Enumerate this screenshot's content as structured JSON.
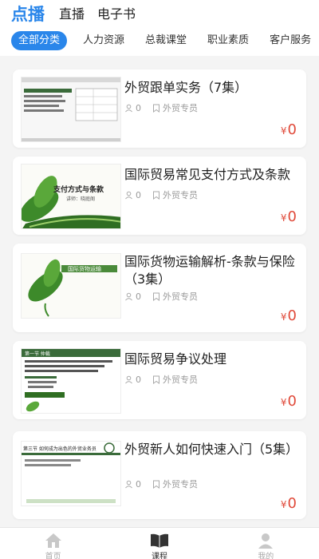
{
  "top_tabs": [
    "点播",
    "直播",
    "电子书"
  ],
  "categories": [
    "全部分类",
    "人力资源",
    "总裁课堂",
    "职业素质",
    "客户服务"
  ],
  "courses": [
    {
      "title": "外贸跟单实务（7集）",
      "count": "0",
      "tag": "外贸专员",
      "price": "0",
      "currency": "¥"
    },
    {
      "title": "国际贸易常见支付方式及条款",
      "count": "0",
      "tag": "外贸专员",
      "price": "0",
      "currency": "¥",
      "thumb_title": "支付方式与条款",
      "thumb_sub": "讲师：晓庭阁"
    },
    {
      "title": "国际货物运输解析-条款与保险（3集）",
      "count": "0",
      "tag": "外贸专员",
      "price": "0",
      "currency": "¥",
      "thumb_title": "国际货物运输"
    },
    {
      "title": "国际贸易争议处理",
      "count": "0",
      "tag": "外贸专员",
      "price": "0",
      "currency": "¥",
      "thumb_title": "第一节 仲裁"
    },
    {
      "title": "外贸新人如何快速入门（5集）",
      "count": "0",
      "tag": "外贸专员",
      "price": "0",
      "currency": "¥",
      "thumb_title": "第三节 如何成为出色的外贸业务员"
    }
  ],
  "bottom_nav": [
    "首页",
    "课程",
    "我的"
  ],
  "colors": {
    "accent": "#2a86ea",
    "price": "#e04a3a",
    "leaf": "#3d8a2a"
  }
}
